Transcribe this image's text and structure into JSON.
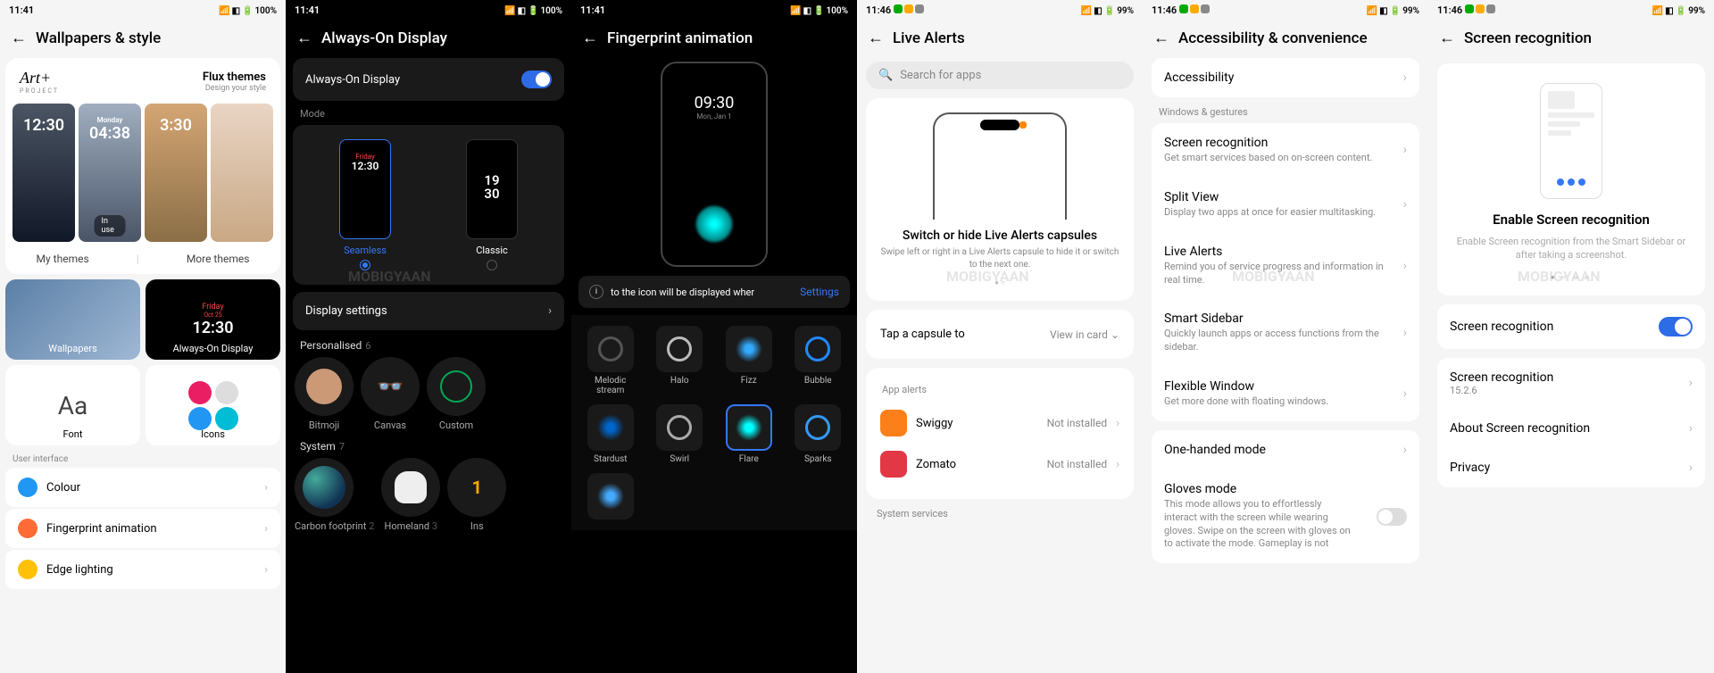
{
  "status": {
    "time1": "11:41",
    "time2": "11:46",
    "battery1": "100%",
    "battery2": "99%"
  },
  "s1": {
    "title": "Wallpapers & style",
    "art_logo": "Art+",
    "art_sub": "PROJECT",
    "flux_title": "Flux themes",
    "flux_sub": "Design your style",
    "clock_day": "Monday",
    "clock_time": "04:38",
    "clock_time2": "12:30",
    "clock_time3": "3:30",
    "inuse": "In use",
    "tab_my": "My themes",
    "tab_more": "More themes",
    "tile_wall": "Wallpapers",
    "tile_aod": "Always-On Display",
    "aod_day": "Friday",
    "aod_date": "Oct 25",
    "aod_time": "12:30",
    "tile_font": "Font",
    "font_sample": "Aa",
    "tile_icons": "Icons",
    "sec_ui": "User interface",
    "row_colour": "Colour",
    "row_fp": "Fingerprint animation",
    "row_edge": "Edge lighting"
  },
  "s2": {
    "title": "Always-On Display",
    "toggle_label": "Always-On Display",
    "mode": "Mode",
    "mini_time": "12:30",
    "classic_time": "19\n30",
    "opt_seamless": "Seamless",
    "opt_classic": "Classic",
    "display_settings": "Display settings",
    "personalised": "Personalised",
    "personalised_n": "6",
    "p_bitmoji": "Bitmoji",
    "p_canvas": "Canvas",
    "p_custom": "Custom",
    "system": "System",
    "system_n": "7",
    "sy_carbon": "Carbon footprint",
    "sy_carbon_n": "2",
    "sy_homeland": "Homeland",
    "sy_homeland_n": "3",
    "sy_ins": "Ins"
  },
  "s3": {
    "title": "Fingerprint animation",
    "preview_time": "09:30",
    "preview_date": "Mon, Jan 1",
    "info_text": "to the icon will be displayed wher",
    "settings": "Settings",
    "anims": [
      "Melodic stream",
      "Halo",
      "Fizz",
      "Bubble",
      "Stardust",
      "Swirl",
      "Flare",
      "Sparks"
    ]
  },
  "s4": {
    "title": "Live Alerts",
    "search_ph": "Search for apps",
    "card_title": "Switch or hide Live Alerts capsules",
    "card_sub": "Swipe left or right in a Live Alerts capsule to hide it or switch to the next one.",
    "tap_label": "Tap a capsule to",
    "tap_value": "View in card",
    "sec_apps": "App alerts",
    "app1": "Swiggy",
    "app2": "Zomato",
    "not_installed": "Not installed",
    "sec_sys": "System services"
  },
  "s5": {
    "title": "Accessibility & convenience",
    "row_acc": "Accessibility",
    "sec_win": "Windows & gestures",
    "r_screen_t": "Screen recognition",
    "r_screen_s": "Get smart services based on on-screen content.",
    "r_split_t": "Split View",
    "r_split_s": "Display two apps at once for easier multitasking.",
    "r_live_t": "Live Alerts",
    "r_live_s": "Remind you of service progress and information in real time.",
    "r_smart_t": "Smart Sidebar",
    "r_smart_s": "Quickly launch apps or access functions from the sidebar.",
    "r_flex_t": "Flexible Window",
    "r_flex_s": "Get more done with floating windows.",
    "r_one": "One-handed mode",
    "r_gloves_t": "Gloves mode",
    "r_gloves_s": "This mode allows you to effortlessly interact with the screen while wearing gloves. Swipe on the screen with gloves on to activate the mode. Gameplay is not"
  },
  "s6": {
    "title": "Screen recognition",
    "card_title": "Enable Screen recognition",
    "card_sub": "Enable Screen recognition from the Smart Sidebar or after taking a screenshot.",
    "row_toggle": "Screen recognition",
    "row_ver_t": "Screen recognition",
    "row_ver_s": "15.2.6",
    "row_about": "About Screen recognition",
    "row_priv": "Privacy"
  },
  "watermark": "MOBIGYAAN"
}
